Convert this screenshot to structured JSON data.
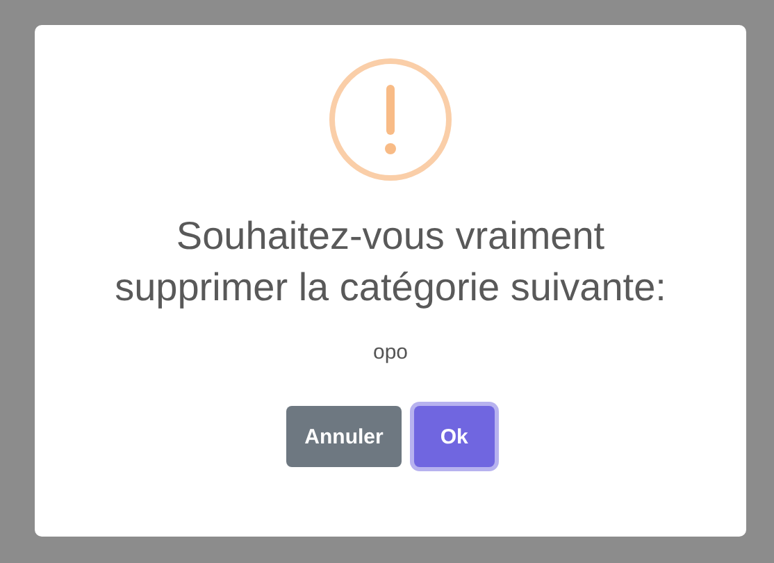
{
  "dialog": {
    "title": "Souhaitez-vous vraiment supprimer la catégorie suivante:",
    "message": "opo",
    "buttons": [
      {
        "label": "Annuler",
        "kind": "cancel",
        "focused": false
      },
      {
        "label": "Ok",
        "kind": "confirm",
        "focused": true
      }
    ]
  }
}
